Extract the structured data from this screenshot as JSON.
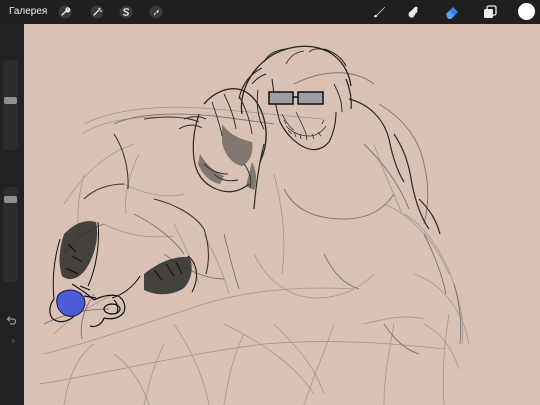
{
  "app": {
    "gallery_label": "Галерея"
  },
  "toolbar": {
    "left_tools": [
      {
        "name": "actions",
        "icon": "wrench-icon"
      },
      {
        "name": "adjustments",
        "icon": "magic-wand-icon"
      },
      {
        "name": "selection",
        "icon": "selection-s-icon"
      },
      {
        "name": "transform",
        "icon": "arrow-cursor-icon"
      }
    ],
    "right_tools": [
      {
        "name": "brush",
        "icon": "brush-icon",
        "active": false
      },
      {
        "name": "smudge",
        "icon": "smudge-icon",
        "active": false
      },
      {
        "name": "eraser",
        "icon": "eraser-icon",
        "active": true
      },
      {
        "name": "layers",
        "icon": "layers-icon",
        "active": false
      }
    ],
    "active_color": "#ffffff",
    "active_tool_color": "#2f7ff5"
  },
  "sidebar": {
    "brush_size": 0.55,
    "brush_opacity": 0.9
  },
  "canvas": {
    "background": "#d9c2b4",
    "accent_blue": "#4e5bd8",
    "lens_color": "#9aa0a4"
  }
}
